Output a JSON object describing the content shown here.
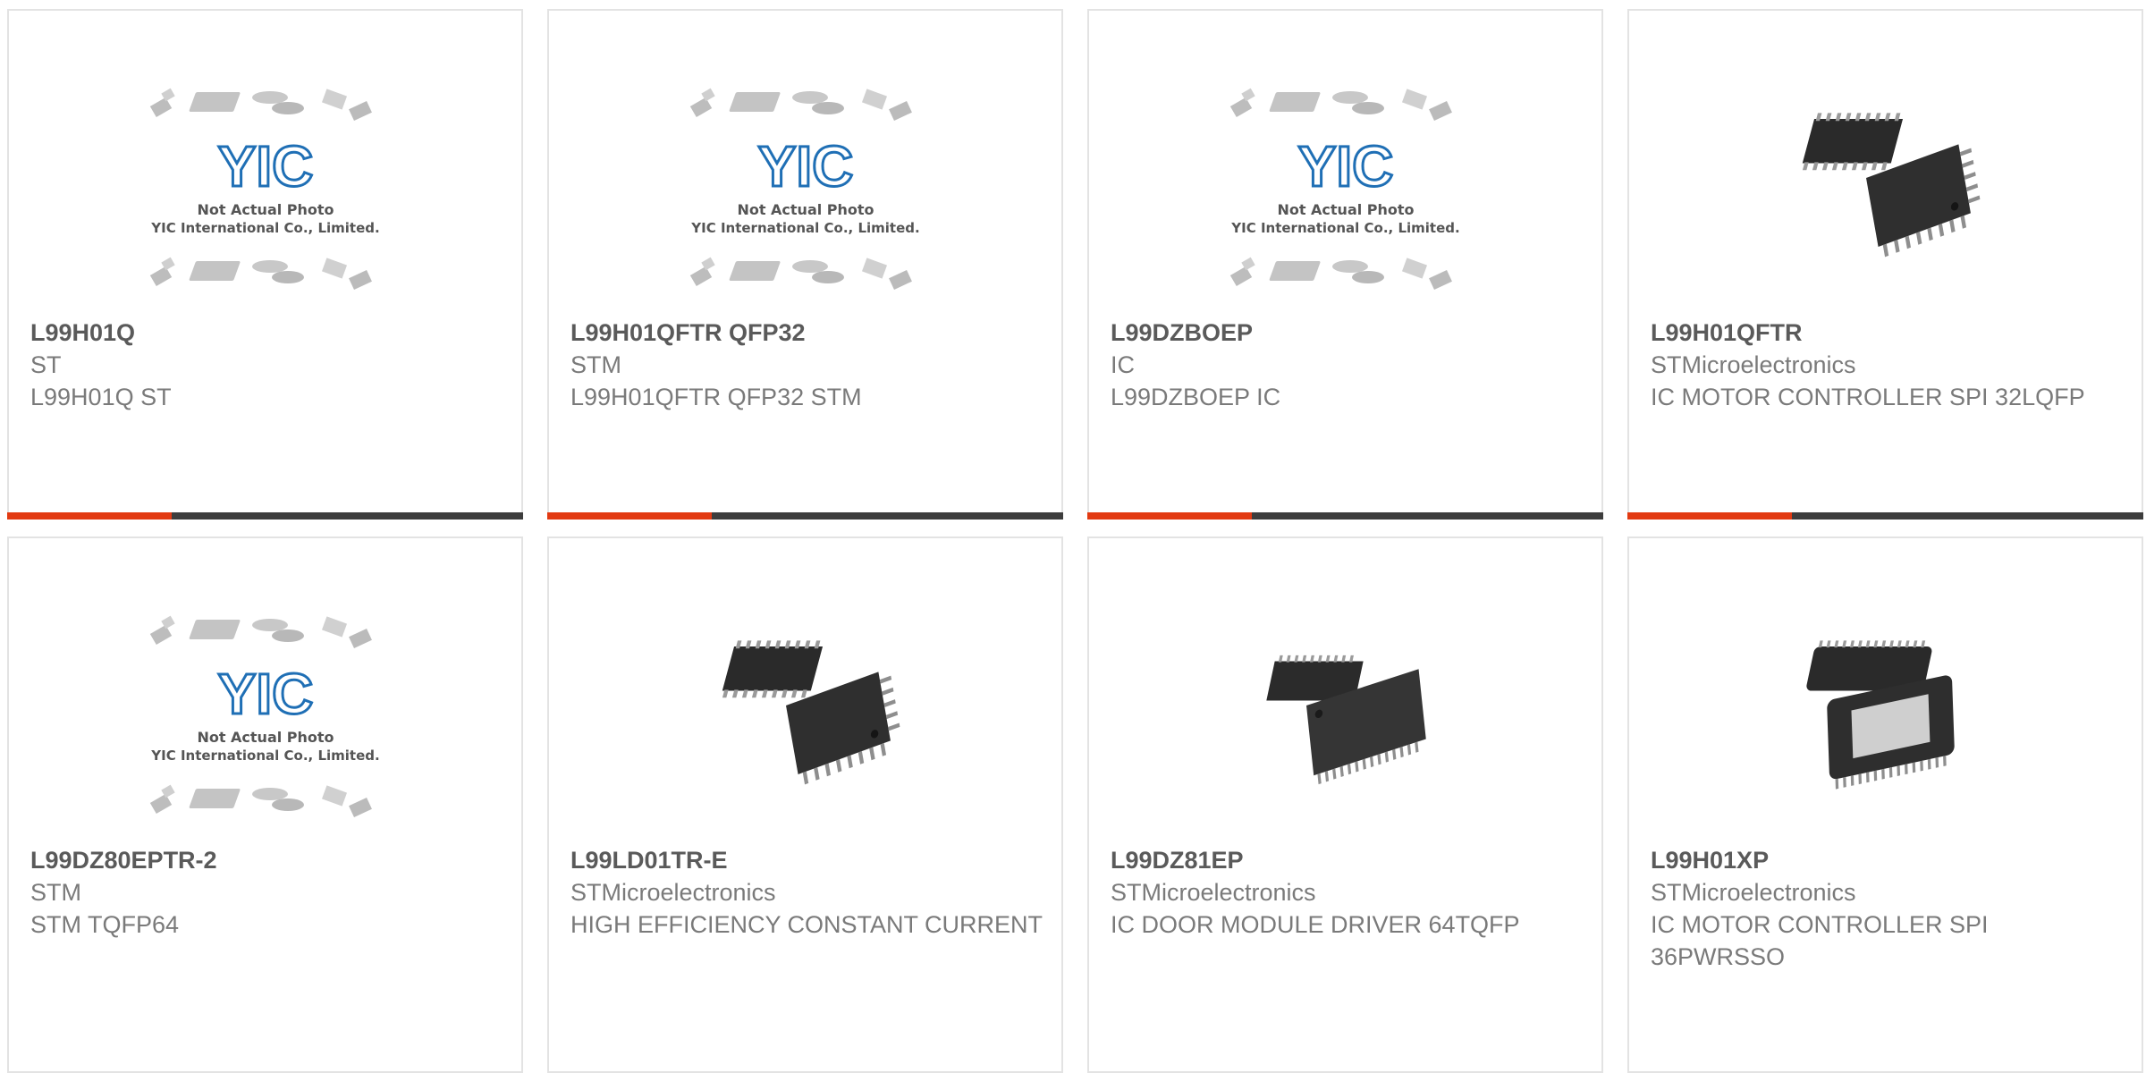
{
  "products": [
    {
      "part": "L99H01Q",
      "mfr": "ST",
      "desc": "L99H01Q ST",
      "image": "placeholder"
    },
    {
      "part": "L99H01QFTR QFP32",
      "mfr": "STM",
      "desc": "L99H01QFTR QFP32 STM",
      "image": "placeholder"
    },
    {
      "part": "L99DZBOEP",
      "mfr": "IC",
      "desc": "L99DZBOEP IC",
      "image": "placeholder"
    },
    {
      "part": "L99H01QFTR",
      "mfr": "STMicroelectronics",
      "desc": "IC MOTOR CONTROLLER SPI 32LQFP",
      "image": "qfp32"
    },
    {
      "part": "L99DZ80EPTR-2",
      "mfr": "STM",
      "desc": "STM TQFP64",
      "image": "placeholder"
    },
    {
      "part": "L99LD01TR-E",
      "mfr": "STMicroelectronics",
      "desc": "HIGH EFFICIENCY CONSTANT CURRENT",
      "image": "qfp32"
    },
    {
      "part": "L99DZ81EP",
      "mfr": "STMicroelectronics",
      "desc": "IC DOOR MODULE DRIVER 64TQFP",
      "image": "tqfp64"
    },
    {
      "part": "L99H01XP",
      "mfr": "STMicroelectronics",
      "desc": "IC MOTOR CONTROLLER SPI 36PWRSSO",
      "image": "pwrsso"
    }
  ],
  "placeholder": {
    "brand": "YIC",
    "line1": "Not Actual Photo",
    "line2": "YIC International Co., Limited."
  },
  "colors": {
    "accent": "#e23a12",
    "bar": "#3d3d3d",
    "logo": "#1f6fb5"
  }
}
